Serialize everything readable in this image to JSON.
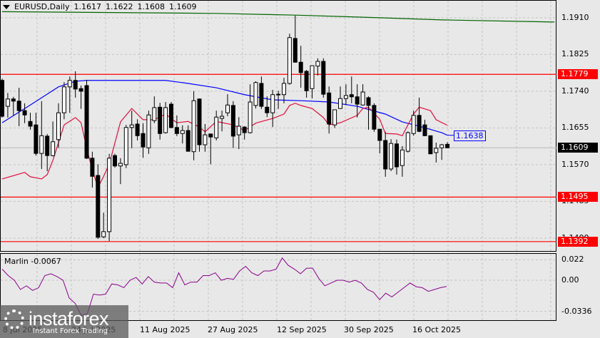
{
  "header": {
    "symbol": "EURUSD,Daily",
    "open": "1.1617",
    "high": "1.1622",
    "low": "1.1608",
    "close": "1.1609"
  },
  "price_axis": [
    "1.1910",
    "1.1825",
    "1.1740",
    "1.1655",
    "1.1570",
    "1.1485",
    "1.1400"
  ],
  "price_axis_values": [
    1.191,
    1.1825,
    1.174,
    1.1655,
    1.157,
    1.1485,
    1.14
  ],
  "levels": [
    {
      "label": "1.1779",
      "value": 1.1779,
      "color": "#ff0000"
    },
    {
      "label": "1.1495",
      "value": 1.1495,
      "color": "#ff0000"
    },
    {
      "label": "1.1392",
      "value": 1.1392,
      "color": "#ff0000"
    }
  ],
  "current_price": {
    "label": "1.1609",
    "value": 1.1609
  },
  "ma_blue_label": "1.1638",
  "colors": {
    "bg": "#e8e8e8",
    "grid": "#c0c0c0",
    "blue_ma": "#0000ff",
    "red_ma": "#e0103c",
    "green_ma": "#006400",
    "marlin": "#8b008b",
    "level": "#ff0000"
  },
  "candles": [
    [
      1.1765,
      1.1769,
      1.1679,
      1.1682
    ],
    [
      1.1705,
      1.1736,
      1.1679,
      1.1722
    ],
    [
      1.1722,
      1.1727,
      1.1684,
      1.1717
    ],
    [
      1.1717,
      1.1748,
      1.1659,
      1.1695
    ],
    [
      1.1695,
      1.1712,
      1.1666,
      1.1685
    ],
    [
      1.167,
      1.169,
      1.1651,
      1.1659
    ],
    [
      1.1662,
      1.169,
      1.1591,
      1.1596
    ],
    [
      1.1596,
      1.1717,
      1.156,
      1.1637
    ],
    [
      1.1636,
      1.1641,
      1.1555,
      1.1591
    ],
    [
      1.1591,
      1.167,
      1.1589,
      1.1623
    ],
    [
      1.1628,
      1.1712,
      1.1609,
      1.169
    ],
    [
      1.169,
      1.1761,
      1.1675,
      1.175
    ],
    [
      1.175,
      1.1774,
      1.169,
      1.1765
    ],
    [
      1.1765,
      1.1786,
      1.1725,
      1.1745
    ],
    [
      1.1746,
      1.1753,
      1.1699,
      1.174
    ],
    [
      1.1753,
      1.1766,
      1.1583,
      1.1585
    ],
    [
      1.1585,
      1.16,
      1.1517,
      1.1543
    ],
    [
      1.1545,
      1.1571,
      1.1398,
      1.1402
    ],
    [
      1.1403,
      1.1459,
      1.14,
      1.1415
    ],
    [
      1.1415,
      1.1595,
      1.1393,
      1.1585
    ],
    [
      1.1591,
      1.1595,
      1.1563,
      1.1567
    ],
    [
      1.1567,
      1.1585,
      1.1525,
      1.1573
    ],
    [
      1.157,
      1.1662,
      1.1562,
      1.1656
    ],
    [
      1.1656,
      1.1695,
      1.1608,
      1.1662
    ],
    [
      1.1664,
      1.1675,
      1.1626,
      1.1637
    ],
    [
      1.1642,
      1.1666,
      1.1586,
      1.1611
    ],
    [
      1.1609,
      1.1695,
      1.1595,
      1.1685
    ],
    [
      1.1672,
      1.1728,
      1.1666,
      1.1702
    ],
    [
      1.1703,
      1.1713,
      1.1628,
      1.1642
    ],
    [
      1.1644,
      1.1715,
      1.1642,
      1.1702
    ],
    [
      1.171,
      1.1715,
      1.1654,
      1.1656
    ],
    [
      1.1656,
      1.1684,
      1.1636,
      1.1642
    ],
    [
      1.1642,
      1.1661,
      1.1619,
      1.1649
    ],
    [
      1.1649,
      1.1661,
      1.16,
      1.1601
    ],
    [
      1.16,
      1.174,
      1.158,
      1.1718
    ],
    [
      1.1722,
      1.1723,
      1.16,
      1.1616
    ],
    [
      1.1616,
      1.1664,
      1.16,
      1.1639
    ],
    [
      1.1641,
      1.1642,
      1.1571,
      1.1634
    ],
    [
      1.1632,
      1.1695,
      1.1626,
      1.168
    ],
    [
      1.1677,
      1.1695,
      1.1647,
      1.1682
    ],
    [
      1.169,
      1.1733,
      1.1682,
      1.1708
    ],
    [
      1.1707,
      1.1717,
      1.1609,
      1.1636
    ],
    [
      1.1639,
      1.168,
      1.1606,
      1.1659
    ],
    [
      1.1657,
      1.1659,
      1.1628,
      1.1644
    ],
    [
      1.1644,
      1.1756,
      1.1642,
      1.1715
    ],
    [
      1.1707,
      1.1763,
      1.17,
      1.176
    ],
    [
      1.1758,
      1.1774,
      1.1699,
      1.1705
    ],
    [
      1.1703,
      1.1728,
      1.168,
      1.169
    ],
    [
      1.169,
      1.1743,
      1.1657,
      1.1732
    ],
    [
      1.1732,
      1.1741,
      1.1699,
      1.1733
    ],
    [
      1.1732,
      1.1771,
      1.1712,
      1.1758
    ],
    [
      1.1758,
      1.1873,
      1.1755,
      1.1864
    ],
    [
      1.1862,
      1.1915,
      1.1806,
      1.1807
    ],
    [
      1.1807,
      1.1845,
      1.1748,
      1.1783
    ],
    [
      1.1786,
      1.1789,
      1.1725,
      1.1741
    ],
    [
      1.1746,
      1.1799,
      1.1723,
      1.1799
    ],
    [
      1.1798,
      1.1816,
      1.1776,
      1.1809
    ],
    [
      1.1809,
      1.1816,
      1.1725,
      1.1733
    ],
    [
      1.1736,
      1.1751,
      1.1642,
      1.1664
    ],
    [
      1.1662,
      1.1697,
      1.1655,
      1.1697
    ],
    [
      1.17,
      1.1751,
      1.1699,
      1.1723
    ],
    [
      1.1723,
      1.1756,
      1.1708,
      1.173
    ],
    [
      1.1732,
      1.1774,
      1.1712,
      1.1727
    ],
    [
      1.1727,
      1.1756,
      1.1679,
      1.171
    ],
    [
      1.1708,
      1.1756,
      1.1707,
      1.1738
    ],
    [
      1.1725,
      1.1728,
      1.1651,
      1.1707
    ],
    [
      1.1707,
      1.1712,
      1.1646,
      1.1652
    ],
    [
      1.1652,
      1.1652,
      1.1596,
      1.1626
    ],
    [
      1.1626,
      1.1646,
      1.1542,
      1.156
    ],
    [
      1.156,
      1.1629,
      1.1555,
      1.1619
    ],
    [
      1.1618,
      1.1628,
      1.1547,
      1.1565
    ],
    [
      1.1568,
      1.1613,
      1.1542,
      1.1604
    ],
    [
      1.1601,
      1.1647,
      1.1598,
      1.1644
    ],
    [
      1.1642,
      1.1695,
      1.1637,
      1.1684
    ],
    [
      1.1684,
      1.1725,
      1.1645,
      1.1647
    ],
    [
      1.1662,
      1.1674,
      1.1636,
      1.1637
    ],
    [
      1.1637,
      1.1637,
      1.1595,
      1.1595
    ],
    [
      1.1598,
      1.1621,
      1.1575,
      1.1608
    ],
    [
      1.1609,
      1.1618,
      1.1581,
      1.1616
    ],
    [
      1.1617,
      1.1622,
      1.1608,
      1.1609
    ]
  ],
  "ma_blue": [
    [
      0,
      1.1667
    ],
    [
      5,
      1.1708
    ],
    [
      10,
      1.175
    ],
    [
      13,
      1.1763
    ],
    [
      15,
      1.1765
    ],
    [
      29,
      1.1765
    ],
    [
      33,
      1.1758
    ],
    [
      38,
      1.1748
    ],
    [
      43,
      1.1732
    ],
    [
      48,
      1.172
    ],
    [
      53,
      1.1718
    ],
    [
      58,
      1.1715
    ],
    [
      63,
      1.1705
    ],
    [
      68,
      1.1687
    ],
    [
      71,
      1.1669
    ],
    [
      74,
      1.1659
    ],
    [
      78,
      1.1644
    ],
    [
      79,
      1.1638
    ]
  ],
  "ma_red": [
    [
      0,
      1.1537
    ],
    [
      4,
      1.1552
    ],
    [
      5,
      1.1542
    ],
    [
      7,
      1.1537
    ],
    [
      8,
      1.1547
    ],
    [
      9,
      1.158
    ],
    [
      11,
      1.1662
    ],
    [
      13,
      1.1679
    ],
    [
      14,
      1.1667
    ],
    [
      15,
      1.1608
    ],
    [
      16,
      1.1558
    ],
    [
      17,
      1.1517
    ],
    [
      18,
      1.1543
    ],
    [
      19,
      1.1571
    ],
    [
      21,
      1.1669
    ],
    [
      23,
      1.17
    ],
    [
      25,
      1.1674
    ],
    [
      27,
      1.1674
    ],
    [
      29,
      1.1687
    ],
    [
      31,
      1.1667
    ],
    [
      33,
      1.167
    ],
    [
      35,
      1.1657
    ],
    [
      36,
      1.1646
    ],
    [
      38,
      1.167
    ],
    [
      41,
      1.1662
    ],
    [
      43,
      1.1649
    ],
    [
      45,
      1.1666
    ],
    [
      48,
      1.1677
    ],
    [
      50,
      1.1687
    ],
    [
      51,
      1.1707
    ],
    [
      52,
      1.1712
    ],
    [
      53,
      1.1707
    ],
    [
      55,
      1.17
    ],
    [
      57,
      1.1679
    ],
    [
      58,
      1.1662
    ],
    [
      60,
      1.1667
    ],
    [
      63,
      1.1684
    ],
    [
      64,
      1.17
    ],
    [
      65,
      1.1703
    ],
    [
      67,
      1.1675
    ],
    [
      68,
      1.1642
    ],
    [
      70,
      1.1641
    ],
    [
      71,
      1.1637
    ],
    [
      73,
      1.1687
    ],
    [
      74,
      1.1703
    ],
    [
      76,
      1.1695
    ],
    [
      77,
      1.1674
    ],
    [
      79,
      1.1661
    ]
  ],
  "ma_green": [
    [
      0,
      1.1924
    ],
    [
      38,
      1.192
    ],
    [
      52,
      1.1916
    ],
    [
      67,
      1.191
    ],
    [
      78,
      1.1905
    ],
    [
      98,
      1.19
    ]
  ],
  "marlin": {
    "label": "Marlin -0.0067",
    "axis": [
      "0.022",
      "0.00",
      "-0.0336"
    ],
    "axis_values": [
      0.022,
      0.0,
      -0.0336
    ],
    "values": [
      0.012,
      0.005,
      0.0,
      -0.01,
      -0.006,
      -0.011,
      -0.008,
      0.005,
      0.007,
      0.004,
      0.0,
      -0.019,
      -0.025,
      -0.038,
      -0.036,
      -0.015,
      -0.016,
      -0.015,
      -0.004,
      -0.005,
      -0.008,
      0.0,
      0.003,
      -0.004,
      0.004,
      -0.002,
      -0.003,
      -0.003,
      -0.008,
      0.008,
      -0.005,
      -0.002,
      -0.002,
      0.005,
      0.005,
      0.008,
      0.0,
      0.002,
      0.001,
      0.01,
      0.015,
      0.008,
      0.005,
      0.01,
      0.01,
      0.012,
      0.024,
      0.016,
      0.012,
      0.007,
      0.013,
      0.013,
      0.002,
      -0.006,
      -0.003,
      0.0,
      0.0,
      -0.002,
      0.0,
      -0.003,
      -0.01,
      -0.013,
      -0.021,
      -0.014,
      -0.018,
      -0.013,
      -0.008,
      -0.003,
      -0.007,
      -0.008,
      -0.012,
      -0.01,
      -0.008,
      -0.0067
    ]
  },
  "dates": [
    "8 Jul 2025",
    "24 Jul 2025",
    "11 Aug 2025",
    "27 Aug 2025",
    "12 Sep 2025",
    "30 Sep 2025",
    "16 Oct 2025"
  ],
  "watermark": {
    "brand": "instaforex",
    "tagline": "Instant Forex Trading"
  }
}
